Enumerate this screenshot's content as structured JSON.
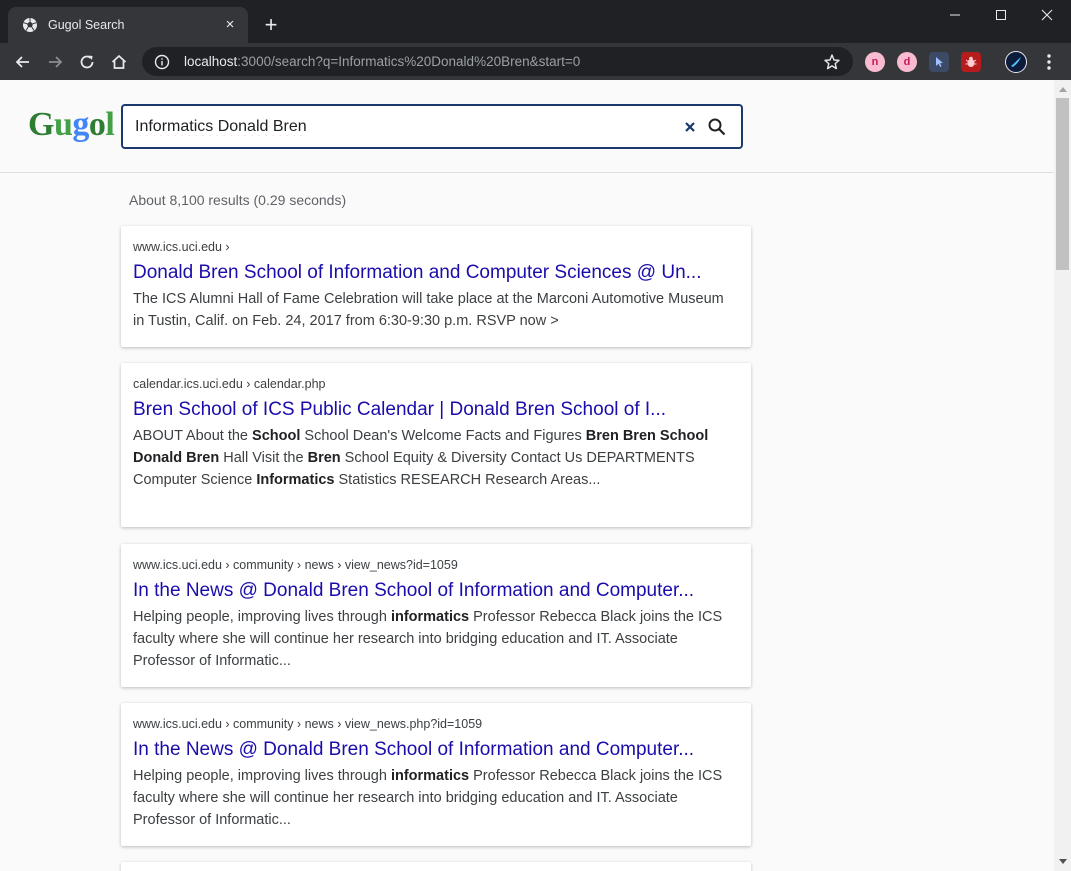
{
  "browser": {
    "tab_title": "Gugol Search",
    "tab_close": "×",
    "new_tab": "+",
    "url_host": "localhost",
    "url_rest": ":3000/search?q=Informatics%20Donald%20Bren&start=0",
    "extensions": [
      {
        "label": "n",
        "bg": "#f8bbd0",
        "fg": "#c2185b"
      },
      {
        "label": "d",
        "bg": "#f8bbd0",
        "fg": "#c2185b"
      }
    ]
  },
  "header": {
    "logo_letters": [
      {
        "ch": "G",
        "color": "#2e7d32"
      },
      {
        "ch": "u",
        "color": "#43a047"
      },
      {
        "ch": "g",
        "color": "#4285f4"
      },
      {
        "ch": "o",
        "color": "#2e7d32"
      },
      {
        "ch": "l",
        "color": "#43a047"
      }
    ],
    "search_value": "Informatics Donald Bren",
    "accent": "#1a3a6e"
  },
  "stats": "About 8,100 results (0.29 seconds)",
  "results": [
    {
      "crumb": "www.ics.uci.edu ›",
      "title": "Donald Bren School of Information and Computer Sciences @ Un...",
      "snippet": [
        {
          "t": "The ICS Alumni Hall of Fame Celebration will take place at the Marconi Automotive Museum in Tustin, Calif. on Feb. 24, 2017 from 6:30-9:30 p.m. RSVP now >",
          "b": false
        }
      ]
    },
    {
      "crumb": "calendar.ics.uci.edu › calendar.php",
      "title": "Bren School of ICS Public Calendar | Donald Bren School of I...",
      "snippet": [
        {
          "t": "ABOUT About the ",
          "b": false
        },
        {
          "t": "School",
          "b": true
        },
        {
          "t": " School Dean's Welcome Facts and Figures ",
          "b": false
        },
        {
          "t": "Bren Bren School Donald Bren",
          "b": true
        },
        {
          "t": " Hall Visit the ",
          "b": false
        },
        {
          "t": "Bren",
          "b": true
        },
        {
          "t": " School Equity & Diversity Contact Us DEPARTMENTS Computer Science ",
          "b": false
        },
        {
          "t": "Informatics",
          "b": true
        },
        {
          "t": " Statistics RESEARCH Research Areas...",
          "b": false
        }
      ]
    },
    {
      "crumb": "www.ics.uci.edu › community › news › view_news?id=1059",
      "title": "In the News @ Donald Bren School of Information and Computer...",
      "snippet": [
        {
          "t": "Helping people, improving lives through ",
          "b": false
        },
        {
          "t": "informatics",
          "b": true
        },
        {
          "t": " Professor Rebecca Black joins the ICS faculty where she will continue her research into bridging education and IT. Associate Professor of Informatic...",
          "b": false
        }
      ]
    },
    {
      "crumb": "www.ics.uci.edu › community › news › view_news.php?id=1059",
      "title": "In the News @ Donald Bren School of Information and Computer...",
      "snippet": [
        {
          "t": "Helping people, improving lives through ",
          "b": false
        },
        {
          "t": "informatics",
          "b": true
        },
        {
          "t": " Professor Rebecca Black joins the ICS faculty where she will continue her research into bridging education and IT. Associate Professor of Informatic...",
          "b": false
        }
      ]
    }
  ]
}
